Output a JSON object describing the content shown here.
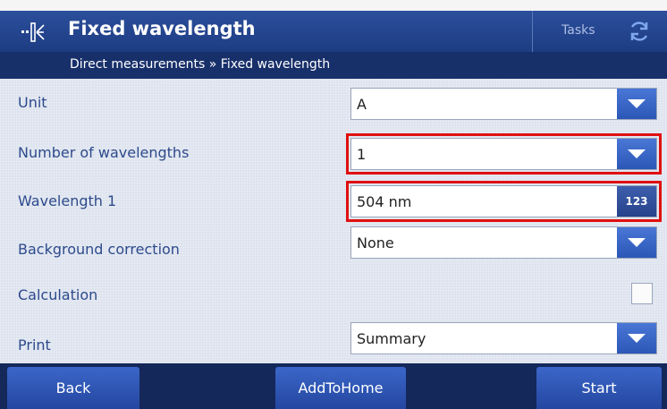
{
  "header": {
    "title": "Fixed wavelength",
    "tasks_label": "Tasks"
  },
  "breadcrumb": "Direct measurements » Fixed wavelength",
  "rows": [
    {
      "label": "Unit",
      "value": "A",
      "control": "dropdown"
    },
    {
      "label": "Number of wavelengths",
      "value": "1",
      "control": "dropdown"
    },
    {
      "label": "Wavelength 1",
      "value": "504 nm",
      "control": "keypad",
      "keypad_label": "123"
    },
    {
      "label": "Background correction",
      "value": "None",
      "control": "dropdown"
    },
    {
      "label": "Calculation",
      "checked": false,
      "control": "checkbox"
    },
    {
      "label": "Print",
      "value": "Summary",
      "control": "dropdown"
    }
  ],
  "footer": {
    "back": "Back",
    "add_to_home": "AddToHome",
    "start": "Start"
  },
  "colors": {
    "header": "#2c4f9c",
    "breadcrumb_bar": "#18306a",
    "accent": "#3b66c9",
    "highlight": "#e01010"
  }
}
